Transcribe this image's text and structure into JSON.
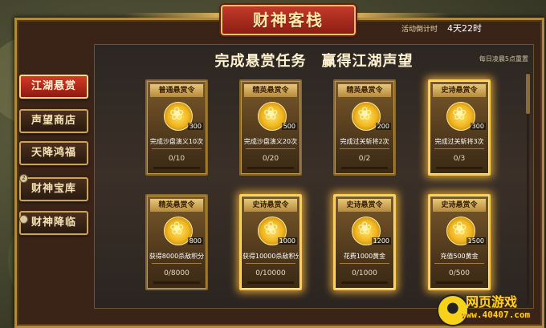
{
  "header": {
    "title": "财神客栈",
    "countdown_label": "活动倒计时",
    "countdown_value": "4天22时"
  },
  "panel": {
    "title": "完成悬赏任务　赢得江湖声望",
    "reset_note": "每日凌晨5点重置"
  },
  "sidebar": {
    "items": [
      {
        "label": "江湖悬赏",
        "active": true
      },
      {
        "label": "声望商店",
        "active": false
      },
      {
        "label": "天降鸿福",
        "active": false
      },
      {
        "label": "财神宝库",
        "active": false
      },
      {
        "label": "财神降临",
        "active": false
      }
    ],
    "badge": "2"
  },
  "cards": [
    {
      "head": "普通悬赏令",
      "qty": "300",
      "desc": "完成沙盘演义10次",
      "progress": "0/10",
      "epic": false
    },
    {
      "head": "精英悬赏令",
      "qty": "500",
      "desc": "完成沙盘演义20次",
      "progress": "0/20",
      "epic": false
    },
    {
      "head": "精英悬赏令",
      "qty": "200",
      "desc": "完成过关斩将2次",
      "progress": "0/2",
      "epic": false
    },
    {
      "head": "史诗悬赏令",
      "qty": "300",
      "desc": "完成过关斩将3次",
      "progress": "0/3",
      "epic": true
    },
    {
      "head": "精英悬赏令",
      "qty": "800",
      "desc": "获得8000杀敌积分",
      "progress": "0/8000",
      "epic": false
    },
    {
      "head": "史诗悬赏令",
      "qty": "1000",
      "desc": "获得10000杀敌积分",
      "progress": "0/10000",
      "epic": true
    },
    {
      "head": "史诗悬赏令",
      "qty": "1200",
      "desc": "花费1000黄金",
      "progress": "0/1000",
      "epic": true
    },
    {
      "head": "史诗悬赏令",
      "qty": "1500",
      "desc": "充值500黄金",
      "progress": "0/500",
      "epic": true
    }
  ],
  "watermark": {
    "title": "网页游戏",
    "url": "www.40407.com"
  },
  "colors": {
    "accent_red": "#c23a2a",
    "gold": "#ffcc4a",
    "frame": "#b08a3e"
  }
}
